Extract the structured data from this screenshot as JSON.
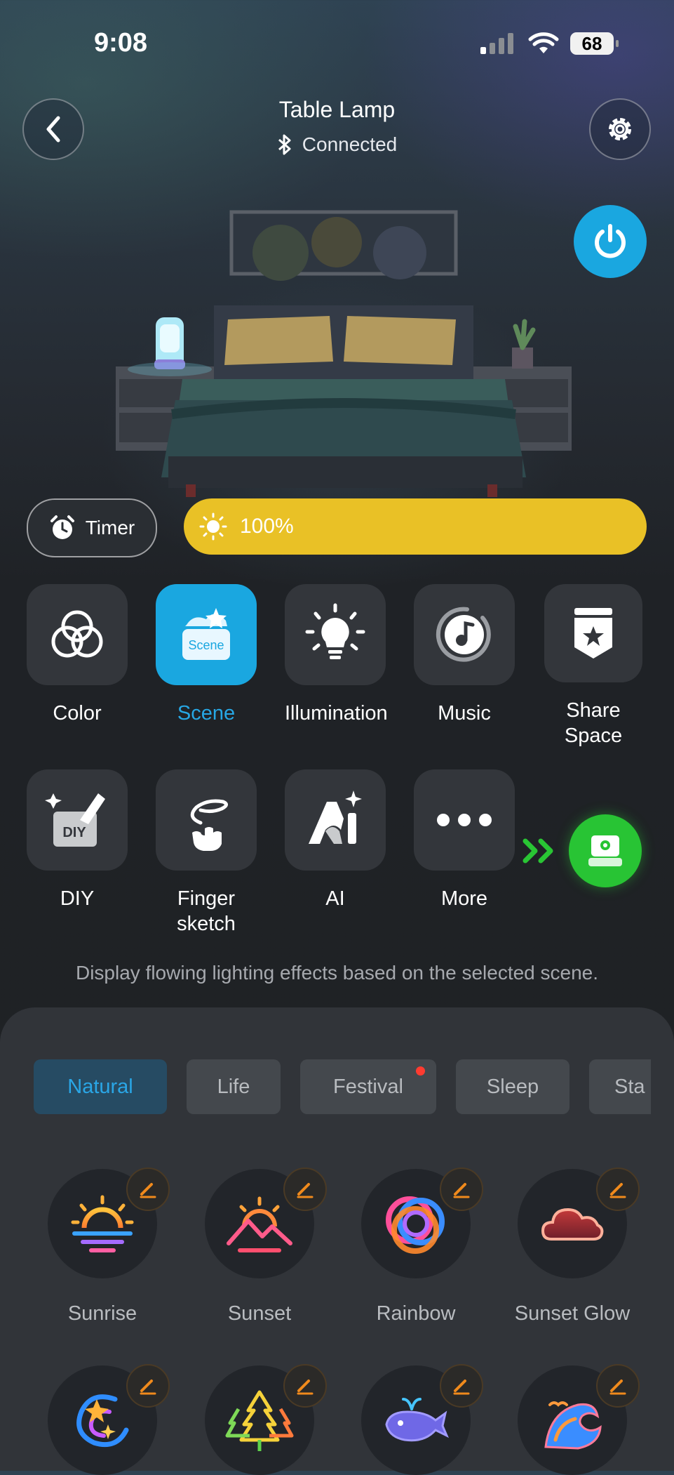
{
  "status_bar": {
    "time": "9:08",
    "battery": "68"
  },
  "header": {
    "title": "Table Lamp",
    "connection": "Connected"
  },
  "brightness": {
    "label": "100%",
    "level": 1.0
  },
  "timer": {
    "label": "Timer"
  },
  "functions": [
    {
      "label": "Color",
      "icon": "color-rings-icon",
      "active": false
    },
    {
      "label": "Scene",
      "icon": "scene-icon",
      "badge": "Scene",
      "active": true
    },
    {
      "label": "Illumination",
      "icon": "lightbulb-icon",
      "active": false
    },
    {
      "label": "Music",
      "icon": "music-icon",
      "active": false
    },
    {
      "label": "Share Space",
      "icon": "share-space-icon",
      "active": false
    },
    {
      "label": "DIY",
      "icon": "diy-icon",
      "badge": "DIY",
      "active": false
    },
    {
      "label": "Finger sketch",
      "icon": "finger-sketch-icon",
      "active": false
    },
    {
      "label": "AI",
      "icon": "ai-icon",
      "active": false
    },
    {
      "label": "More",
      "icon": "more-icon",
      "active": false
    }
  ],
  "description": "Display flowing lighting effects based on the selected scene.",
  "tabs": [
    "Natural",
    "Life",
    "Festival",
    "Sleep",
    "Sta"
  ],
  "active_tab": "Natural",
  "scenes": [
    {
      "name": "Sunrise",
      "icon": "sunrise-icon"
    },
    {
      "name": "Sunset",
      "icon": "sunset-icon"
    },
    {
      "name": "Rainbow",
      "icon": "rainbow-icon"
    },
    {
      "name": "Sunset Glow",
      "icon": "sunset-glow-icon"
    },
    {
      "name": "",
      "icon": "aurora-icon"
    },
    {
      "name": "",
      "icon": "forest-icon"
    },
    {
      "name": "",
      "icon": "whale-icon"
    },
    {
      "name": "",
      "icon": "wave-icon"
    }
  ],
  "colors": {
    "accent": "#1aa7e0",
    "brightness_bar": "#e9c126",
    "promo_green": "#28c434",
    "edit_orange": "#f08a1c"
  }
}
